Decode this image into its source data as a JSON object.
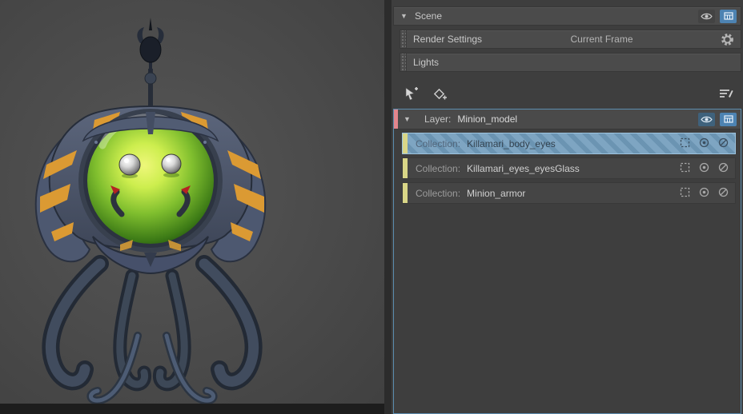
{
  "colors": {
    "selection_blue": "#5b8cae",
    "stripe_light": "#7ea5c2",
    "stripe_dark": "#6b94b2",
    "layer_strip_pink": "#e2858c",
    "collection_strip_yellow": "#d9d687",
    "chip_blue": "#4d83b2",
    "panel_bg": "#3e3e3e"
  },
  "scene": {
    "label": "Scene"
  },
  "render_settings": {
    "label": "Render Settings",
    "value": "Current Frame"
  },
  "lights": {
    "label": "Lights"
  },
  "layer": {
    "label": "Layer:",
    "name": "Minion_model"
  },
  "collections": [
    {
      "label": "Collection:",
      "name": "Killamari_body_eyes"
    },
    {
      "label": "Collection:",
      "name": "Killamari_eyes_eyesGlass"
    },
    {
      "label": "Collection:",
      "name": "Minion_armor"
    }
  ]
}
